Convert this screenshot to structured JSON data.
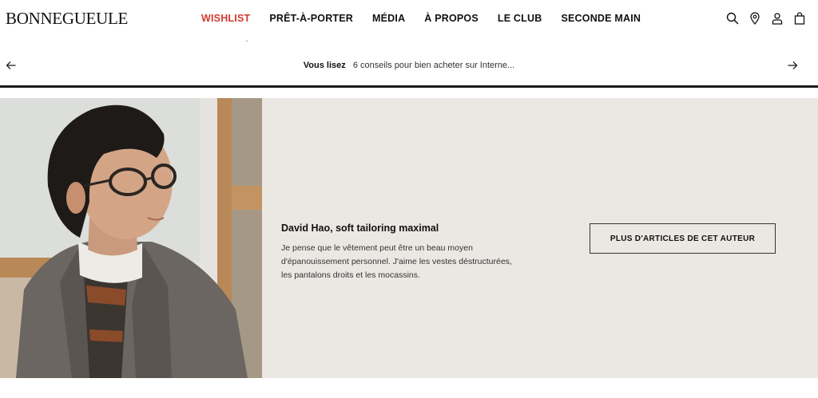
{
  "header": {
    "logo": "BONNEGUEULE",
    "nav": [
      {
        "label": "WISHLIST"
      },
      {
        "label": "PRÊT-À-PORTER"
      },
      {
        "label": "MÉDIA"
      },
      {
        "label": "À PROPOS"
      },
      {
        "label": "LE CLUB"
      },
      {
        "label": "SECONDE MAIN"
      }
    ],
    "icons": [
      "search-icon",
      "location-pin-icon",
      "user-icon",
      "shopping-bag-icon"
    ],
    "accent_color": "#d23a2e"
  },
  "reading": {
    "label": "Vous lisez",
    "title": "6 conseils pour bien acheter sur Interne..."
  },
  "author": {
    "name": "David Hao, soft tailoring maximal",
    "bio": "Je pense que le vêtement peut être un beau moyen d'épanouissement personnel. J'aime les vestes déstructurées, les pantalons droits et les mocassins.",
    "button_label": "PLUS D'ARTICLES DE CET AUTEUR",
    "background_color": "#ebe8e3"
  }
}
